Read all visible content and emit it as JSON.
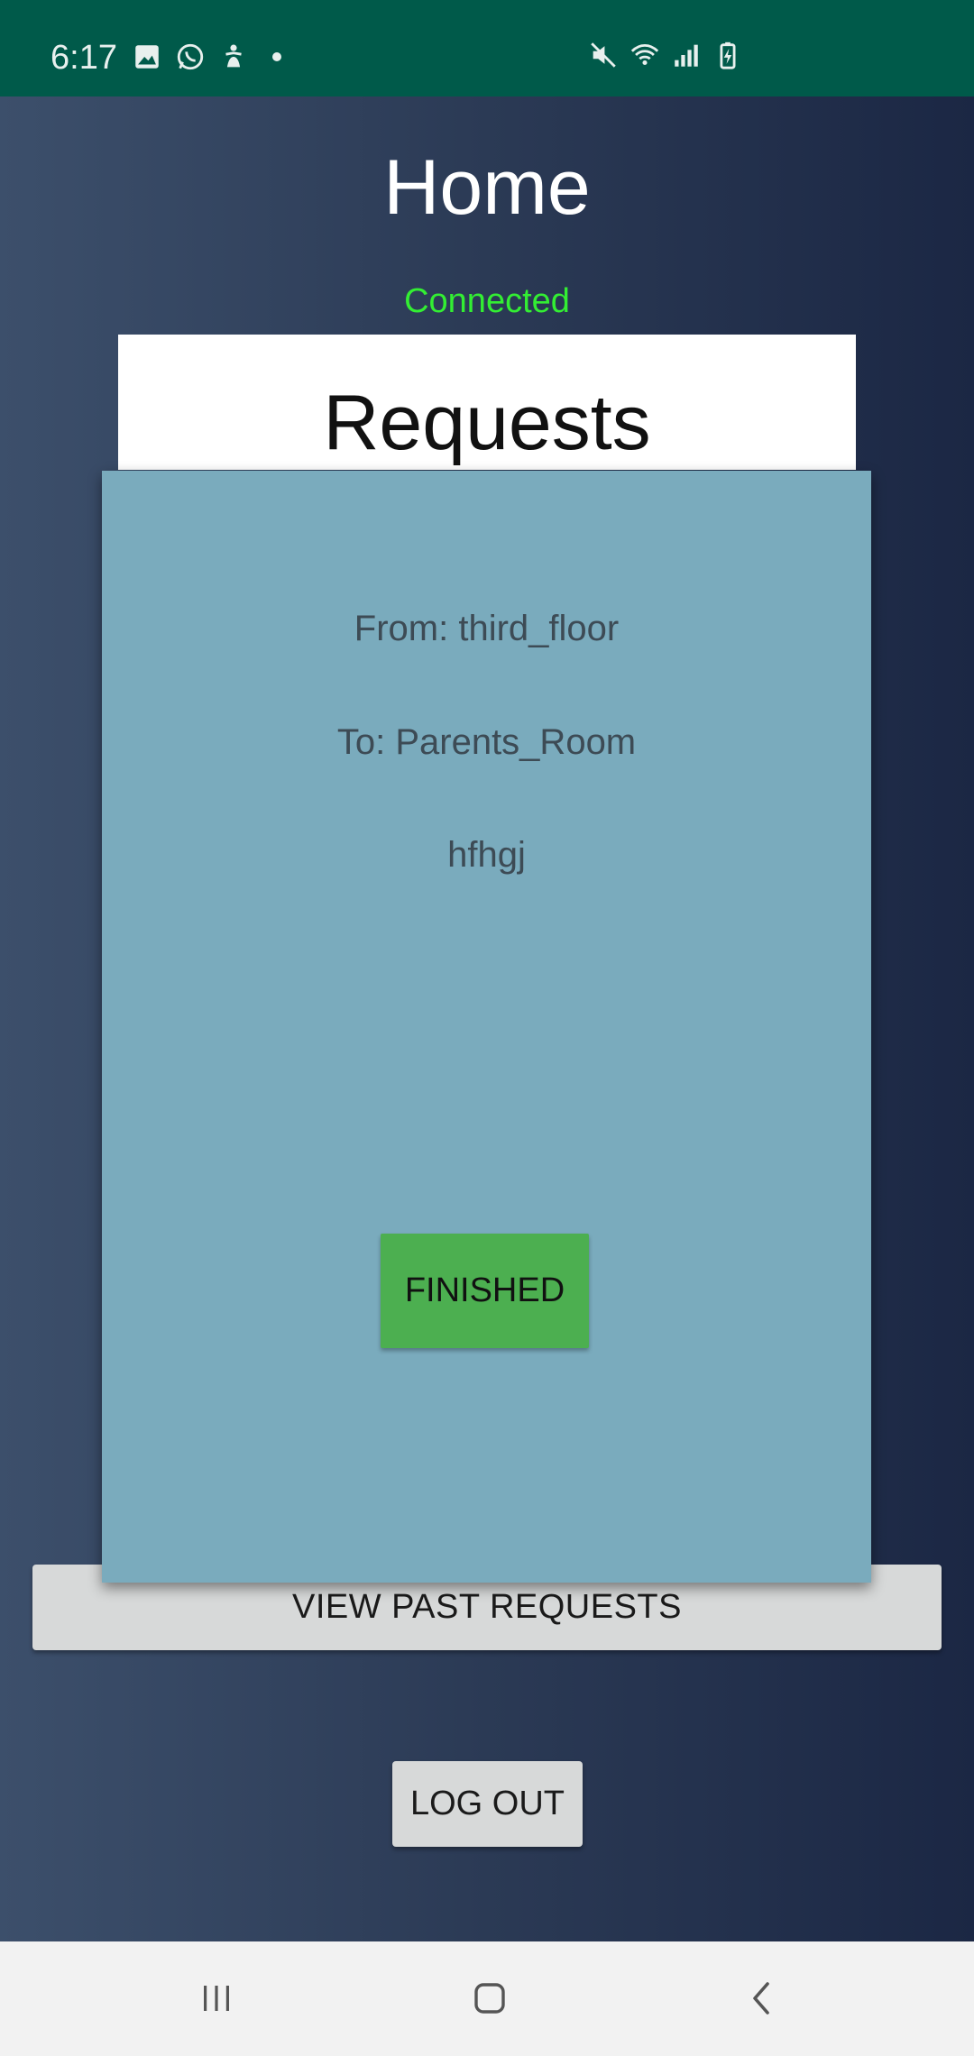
{
  "status_bar": {
    "time": "6:17",
    "left_icons": [
      "image-icon",
      "whatsapp-icon",
      "accessibility-icon",
      "notification-dot-icon"
    ],
    "right_icons": [
      "mute-icon",
      "wifi-icon",
      "signal-icon",
      "battery-charging-icon"
    ]
  },
  "header": {
    "title": "Home",
    "connection_status": "Connected",
    "connection_color": "#33ee33"
  },
  "requests_panel": {
    "title": "Requests"
  },
  "request_card": {
    "from": "From: third_floor",
    "to": "To: Parents_Room",
    "message": "hfhgj",
    "finish_label": "FINISHED",
    "finish_color": "#4caf50"
  },
  "actions": {
    "past_requests_label": "VIEW PAST REQUESTS",
    "logout_label": "LOG OUT"
  },
  "nav_bar": {
    "icons": [
      "recent-apps-icon",
      "home-icon",
      "back-icon"
    ]
  },
  "colors": {
    "status_bar": "#005a4a",
    "card": "#7aabbd",
    "background_gradient": [
      "#3c4f6b",
      "#1b2744"
    ]
  }
}
